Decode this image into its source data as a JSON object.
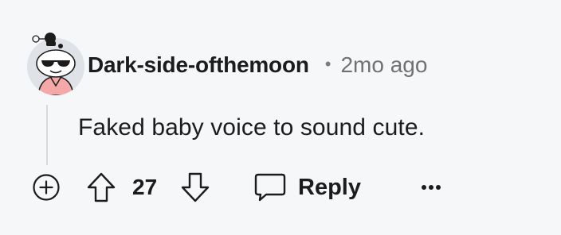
{
  "comment": {
    "username": "Dark-side-ofthemoon",
    "separator": "•",
    "timestamp": "2mo ago",
    "text": "Faked baby voice to sound cute.",
    "votes": "27"
  },
  "actions": {
    "reply_label": "Reply",
    "more_label": "•••"
  },
  "icons": {
    "avatar": "snoo-avatar-icon",
    "expand": "plus-circle-icon",
    "upvote": "arrow-up-icon",
    "downvote": "arrow-down-icon",
    "reply": "speech-bubble-icon",
    "more": "ellipsis-icon"
  },
  "colors": {
    "background": "#f6f7f8",
    "text": "#1c1c1c",
    "muted": "#6f7173",
    "thread_line": "#d7dadc",
    "avatar_shirt": "#f4a8a8"
  }
}
